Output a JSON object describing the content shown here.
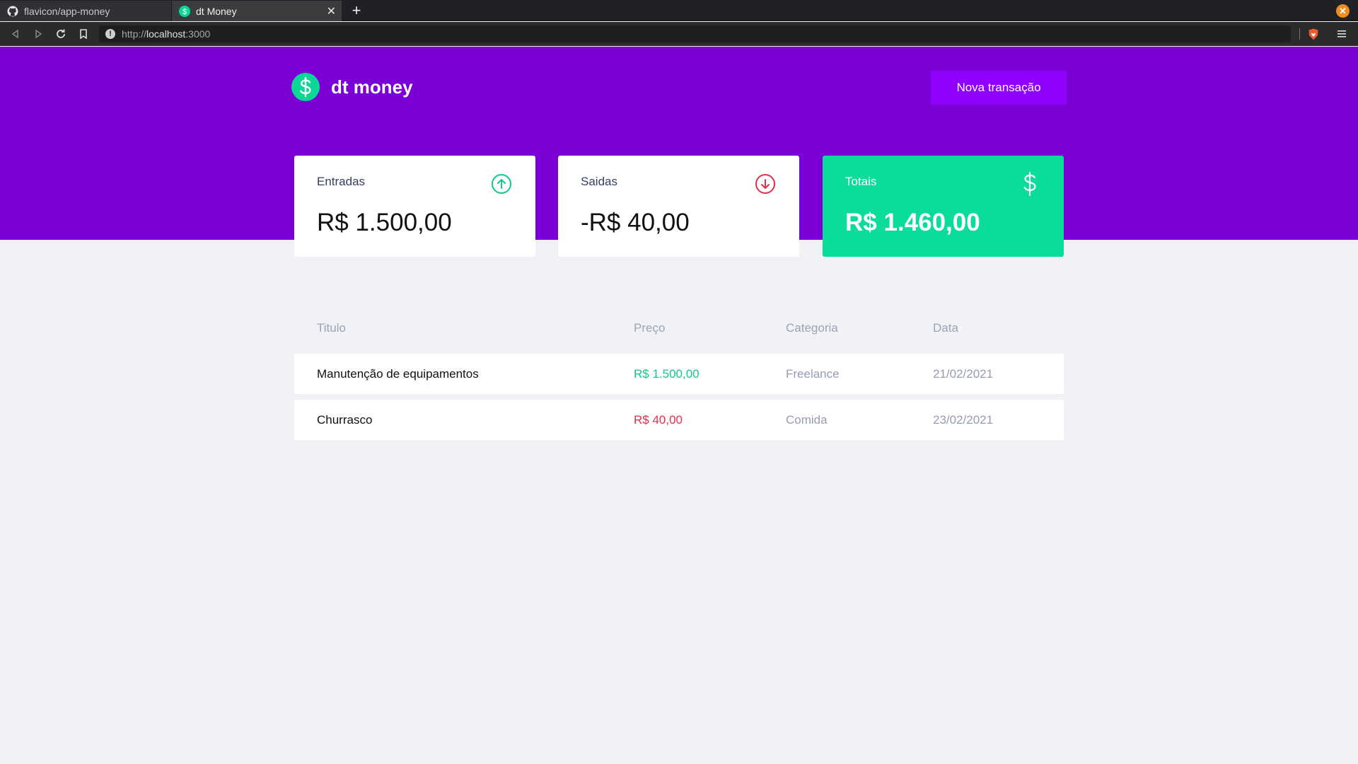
{
  "browser": {
    "tabs": [
      {
        "label": "flavicon/app-money",
        "icon": "github-icon"
      },
      {
        "label": "dt Money",
        "icon": "dollar-favicon-icon"
      }
    ],
    "url_scheme": "http://",
    "url_host": "localhost",
    "url_port": ":3000"
  },
  "app": {
    "logo_text": "dt money",
    "new_transaction_label": "Nova transação",
    "brand_color": "#7a00d6",
    "accent_green": "#0adc9b",
    "accent_red": "#e52e4d"
  },
  "summary": {
    "income": {
      "label": "Entradas",
      "value": "R$ 1.500,00",
      "icon": "arrow-up-circle-icon"
    },
    "outcome": {
      "label": "Saidas",
      "value": "-R$ 40,00",
      "icon": "arrow-down-circle-icon"
    },
    "total": {
      "label": "Totais",
      "value": "R$ 1.460,00",
      "icon": "dollar-icon"
    }
  },
  "table": {
    "headers": [
      "Titulo",
      "Preço",
      "Categoria",
      "Data"
    ],
    "rows": [
      {
        "title": "Manutenção de equipamentos",
        "price": "R$ 1.500,00",
        "type": "deposit",
        "category": "Freelance",
        "date": "21/02/2021"
      },
      {
        "title": "Churrasco",
        "price": "R$ 40,00",
        "type": "withdraw",
        "category": "Comida",
        "date": "23/02/2021"
      }
    ]
  }
}
